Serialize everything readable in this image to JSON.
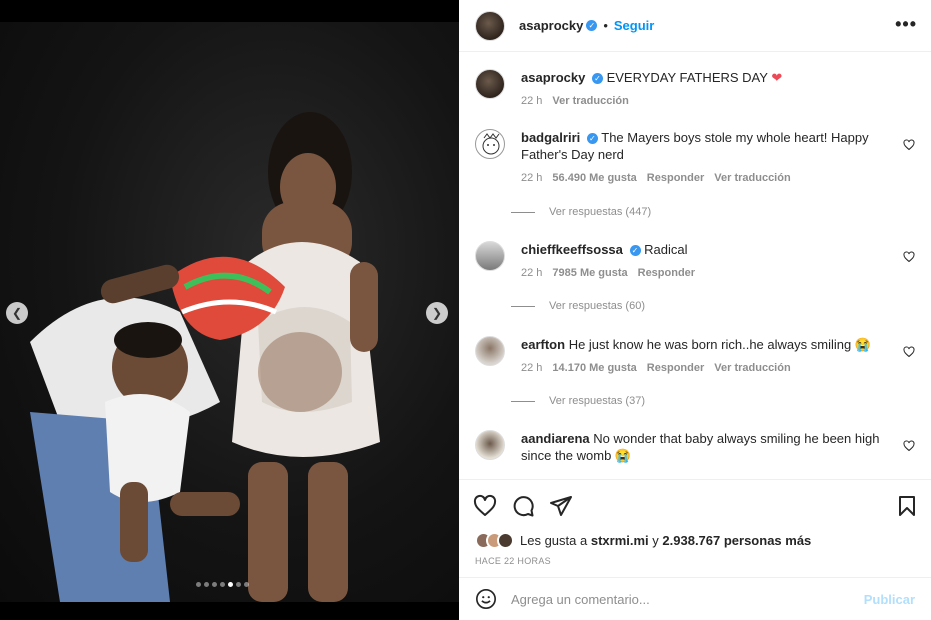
{
  "media": {
    "prev_icon": "chevron-left-icon",
    "next_icon": "chevron-right-icon",
    "carousel_dots": 7,
    "active_dot": 5
  },
  "header": {
    "username": "asaprocky",
    "separator": "•",
    "follow_label": "Seguir",
    "more_icon": "more-horizontal-icon",
    "more_glyph": "•••"
  },
  "caption": {
    "username": "asaprocky",
    "text": "EVERYDAY FATHERS DAY",
    "emoji": "❤",
    "time": "22 h",
    "translate_label": "Ver traducción"
  },
  "comments": [
    {
      "username": "badgalriri",
      "verified": true,
      "text": "The Mayers boys stole my whole heart! Happy Father's Day nerd",
      "time": "22 h",
      "likes": "56.490 Me gusta",
      "reply_label": "Responder",
      "translate_label": "Ver traducción",
      "replies_label": "Ver respuestas (447)"
    },
    {
      "username": "chieffkeeffsossa",
      "verified": true,
      "text": "Radical",
      "time": "22 h",
      "likes": "7985 Me gusta",
      "reply_label": "Responder",
      "translate_label": "",
      "replies_label": "Ver respuestas (60)"
    },
    {
      "username": "earfton",
      "verified": false,
      "text": "He just know he was born rich..he always smiling 😭",
      "time": "22 h",
      "likes": "14.170 Me gusta",
      "reply_label": "Responder",
      "translate_label": "Ver traducción",
      "replies_label": "Ver respuestas (37)"
    },
    {
      "username": "aandiarena",
      "verified": false,
      "text": "No wonder that baby always smiling he been high since the womb 😭",
      "time": "",
      "likes": "",
      "reply_label": "",
      "translate_label": "",
      "replies_label": ""
    }
  ],
  "actions": {
    "like_icon": "heart-icon",
    "comment_icon": "comment-icon",
    "share_icon": "send-icon",
    "save_icon": "bookmark-icon",
    "likes_prefix": "Les gusta a",
    "likes_user": "stxrmi.mi",
    "likes_conj": "y",
    "likes_others": "2.938.767 personas más",
    "time_ago": "HACE 22 HORAS"
  },
  "add_comment": {
    "emoji_icon": "smiley-icon",
    "placeholder": "Agrega un comentario...",
    "publish_label": "Publicar"
  },
  "colors": {
    "accent": "#0095f6",
    "verified": "#3897f0",
    "heart_red": "#ed4956",
    "muted": "#8e8e8e",
    "publish_disabled": "#b2dffc"
  }
}
